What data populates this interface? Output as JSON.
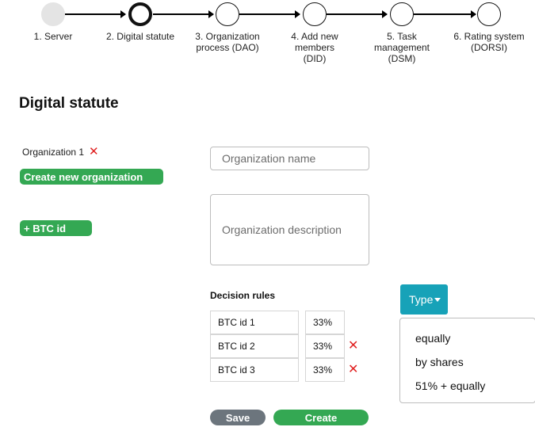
{
  "stepper": {
    "steps": [
      {
        "label": "1. Server",
        "state": "done"
      },
      {
        "label": "2. Digital statute",
        "state": "active"
      },
      {
        "label": "3. Organization\nprocess (DAO)",
        "state": "pending"
      },
      {
        "label": "4. Add new\nmembers\n(DID)",
        "state": "pending"
      },
      {
        "label": "5. Task\nmanagement\n(DSM)",
        "state": "pending"
      },
      {
        "label": "6. Rating system\n(DORSI)",
        "state": "pending"
      }
    ]
  },
  "page": {
    "title": "Digital statute"
  },
  "sidebar": {
    "organization": "Organization 1",
    "remove_icon": "close-icon",
    "create_org_label": "Create new organization",
    "add_btc_label": "+ BTC id"
  },
  "form": {
    "name_placeholder": "Organization name",
    "description_placeholder": "Organization description"
  },
  "decision_rules": {
    "label": "Decision rules",
    "rows": [
      {
        "id": "BTC id 1",
        "share": "33%",
        "removable": false
      },
      {
        "id": "BTC id 2",
        "share": "33%",
        "removable": true
      },
      {
        "id": "BTC id 3",
        "share": "33%",
        "removable": true
      }
    ]
  },
  "type_dropdown": {
    "label": "Type",
    "options": [
      "equally",
      "by shares",
      "51% + equally"
    ]
  },
  "actions": {
    "save_label": "Save",
    "create_label": "Create"
  },
  "colors": {
    "green": "#34a853",
    "teal": "#17a2b8",
    "gray": "#6c757d",
    "red": "#e02020"
  }
}
